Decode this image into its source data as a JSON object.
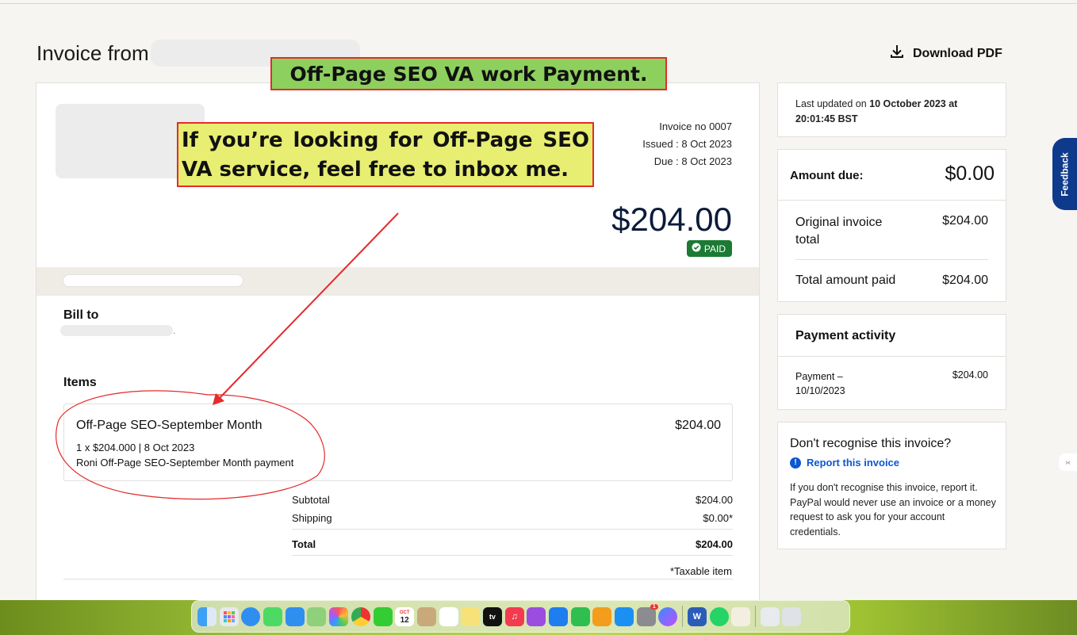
{
  "header": {
    "title": "Invoice from",
    "download_label": "Download PDF"
  },
  "invoice": {
    "number": "Invoice no 0007",
    "issued": "Issued : 8 Oct 2023",
    "due": "Due : 8 Oct 2023",
    "total": "$204.00",
    "status": "PAID",
    "bill_to_label": "Bill to",
    "bill_to_suffix": ".",
    "items_label": "Items",
    "items": [
      {
        "name": "Off-Page SEO-September Month",
        "price": "$204.00",
        "detail": "1 x $204.000 | 8 Oct 2023",
        "description": "Roni Off-Page SEO-September Month payment"
      }
    ],
    "subtotal_label": "Subtotal",
    "subtotal_value": "$204.00",
    "shipping_label": "Shipping",
    "shipping_value": "$0.00*",
    "total_label": "Total",
    "total_value": "$204.00",
    "taxable_note": "*Taxable item"
  },
  "sidebar": {
    "last_updated_prefix": "Last updated on",
    "last_updated_value": "10 October 2023 at 20:01:45 BST",
    "amount_due_label": "Amount due:",
    "amount_due_value": "$0.00",
    "original_total_label": "Original invoice total",
    "original_total_value": "$204.00",
    "total_paid_label": "Total amount paid",
    "total_paid_value": "$204.00",
    "payment_activity_title": "Payment activity",
    "payment_label": "Payment – 10/10/2023",
    "payment_value": "$204.00",
    "recognise_title": "Don't recognise this invoice?",
    "report_link": "Report this invoice",
    "recognise_body": "If you don't recognise this invoice, report it. PayPal would never use an invoice or a money request to ask you for your account credentials."
  },
  "feedback_tab": "Feedback",
  "side_tab_glyph": "›‹",
  "annotations": {
    "banner_title": "Off-Page SEO VA work Payment.",
    "banner_message": "If you’re looking for Off-Page SEO VA service, feel free to inbox me."
  },
  "dock": {
    "calendar_month": "OCT",
    "calendar_day": "12",
    "apple_tv": "tv",
    "notification_badge": "1",
    "word_letter": "W",
    "icons": [
      "finder-icon",
      "launchpad-icon",
      "safari-icon",
      "messages-icon",
      "mail-icon",
      "maps-icon",
      "photos-icon",
      "chrome-icon",
      "facetime-icon",
      "calendar-icon",
      "contacts-icon",
      "reminders-icon",
      "notes-icon",
      "apple-tv-icon",
      "music-icon",
      "podcasts-icon",
      "keynote-icon",
      "numbers-icon",
      "pages-icon",
      "app-store-icon",
      "system-settings-icon",
      "messenger-icon",
      "word-icon",
      "whatsapp-icon",
      "textedit-icon",
      "downloads-icon",
      "trash-icon"
    ]
  },
  "colors": {
    "paid_badge": "#1b7a33",
    "link": "#0b57d0",
    "feedback_tab": "#0e3a8c",
    "annotation_red": "#e52b2b",
    "banner_green": "#8ed05e",
    "banner_yellow": "#e7ee72"
  }
}
